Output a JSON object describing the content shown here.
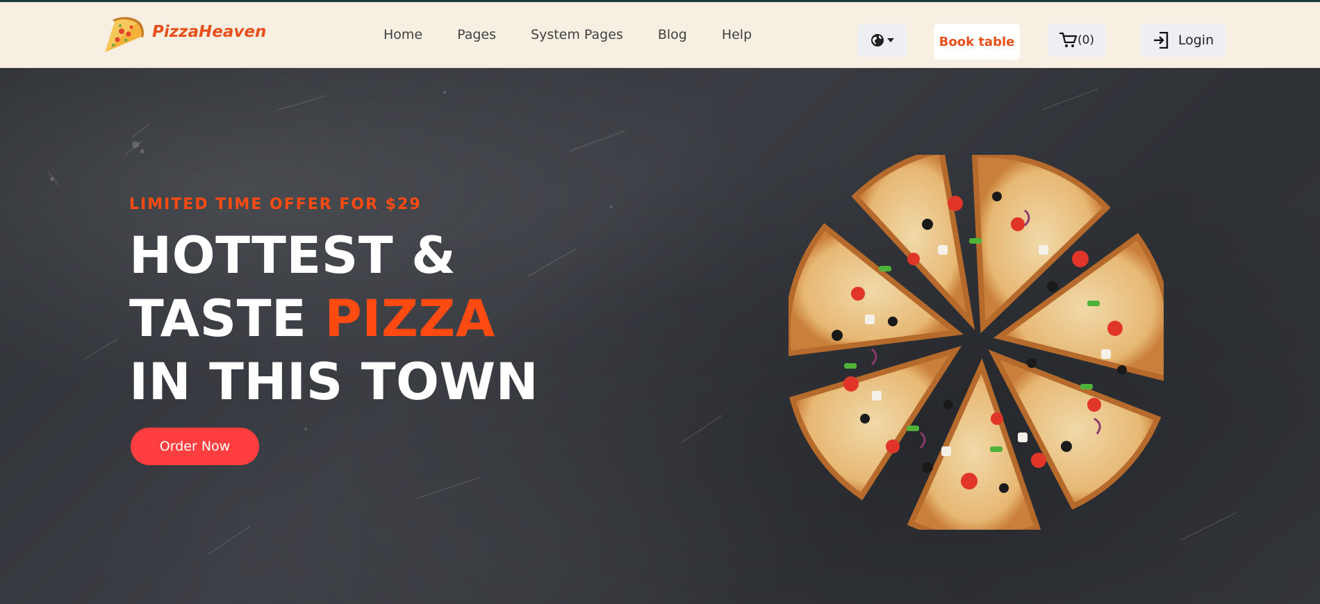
{
  "brand": {
    "name": "PizzaHeaven",
    "logo_icon": "pizza-slice-icon"
  },
  "nav": {
    "items": [
      "Home",
      "Pages",
      "System Pages",
      "Blog",
      "Help"
    ]
  },
  "header_actions": {
    "language_icon": "globe-icon",
    "book_label": "Book table",
    "cart_icon": "cart-icon",
    "cart_count": "(0)",
    "login_icon": "login-icon",
    "login_label": "Login"
  },
  "hero": {
    "offer": "LIMITED TIME OFFER FOR $29",
    "line1": "HOTTEST &",
    "line2_prefix": "TASTE ",
    "line2_accent": "PIZZA",
    "line3": "IN THIS TOWN",
    "cta": "Order Now",
    "image": "pizza-image"
  },
  "colors": {
    "accent": "#ff4a12",
    "brand": "#e8501b",
    "cta": "#ff3f3f",
    "header_bg": "#f7efe2",
    "hero_bg": "#2f3237"
  }
}
